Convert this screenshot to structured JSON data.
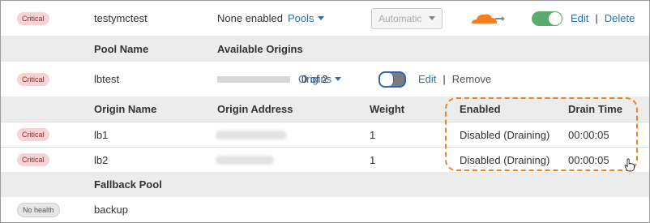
{
  "pool_row": {
    "health": "Critical",
    "name": "testymctest",
    "notification": "None enabled",
    "pools_link": "Pools",
    "steering": "Automatic",
    "edit": "Edit",
    "sep": "|",
    "delete": "Delete",
    "enabled": true,
    "accent_orange": "#f38020",
    "toggle_green": "#5bab70"
  },
  "pool_header": {
    "col1": "Pool Name",
    "col2": "Available Origins"
  },
  "pool": {
    "health": "Critical",
    "name": "lbtest",
    "origins_count": "0 of 2",
    "origins_link": "Origins",
    "edit": "Edit",
    "sep": "|",
    "remove": "Remove",
    "enabled": false
  },
  "origin_header": {
    "name": "Origin Name",
    "address": "Origin Address",
    "weight": "Weight",
    "enabled": "Enabled",
    "drain_time": "Drain Time"
  },
  "origins": [
    {
      "health": "Critical",
      "name": "lb1",
      "weight": "1",
      "enabled": "Disabled (Draining)",
      "drain_time": "00:00:05"
    },
    {
      "health": "Critical",
      "name": "lb2",
      "weight": "1",
      "enabled": "Disabled (Draining)",
      "drain_time": "00:00:05"
    }
  ],
  "fallback_header": {
    "label": "Fallback Pool"
  },
  "fallback": {
    "health": "No health",
    "name": "backup"
  },
  "highlight_color": "#e8852a"
}
